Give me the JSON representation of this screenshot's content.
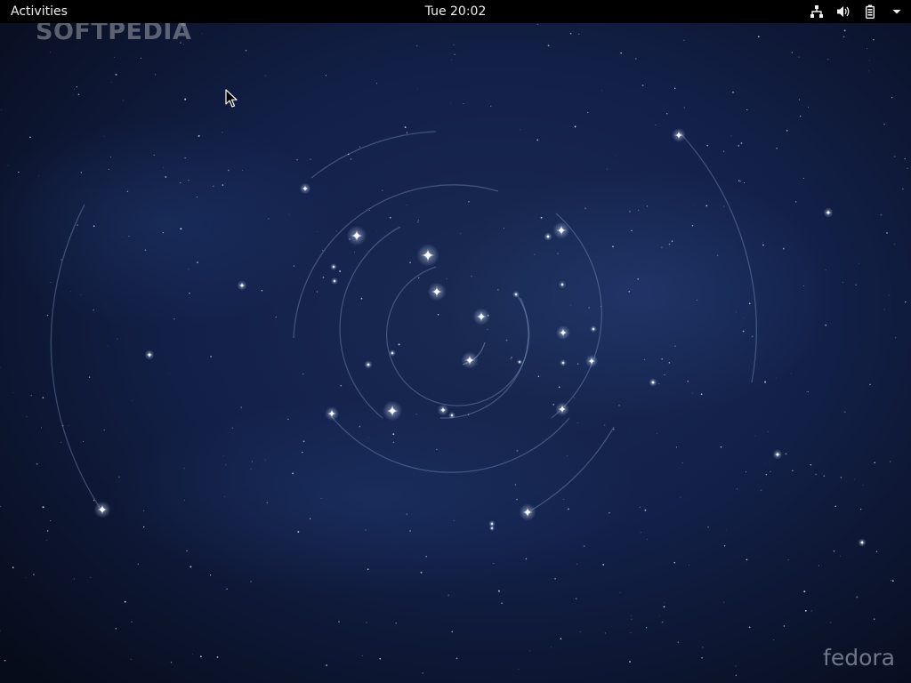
{
  "topbar": {
    "activities_label": "Activities",
    "clock": "Tue 20:02",
    "status_icons": [
      "network-wired-icon",
      "volume-icon",
      "battery-icon",
      "system-menu-arrow-icon"
    ]
  },
  "wallpaper": {
    "name": "fedora starfield wallpaper",
    "watermark_text": "SOFTPEDIA",
    "watermark_mark": "®",
    "logo_text": "fedora"
  },
  "colors": {
    "topbar_bg": "#000000",
    "topbar_text": "#eeeeec",
    "sky_dark": "#0b1224",
    "sky_mid": "#16244a"
  }
}
